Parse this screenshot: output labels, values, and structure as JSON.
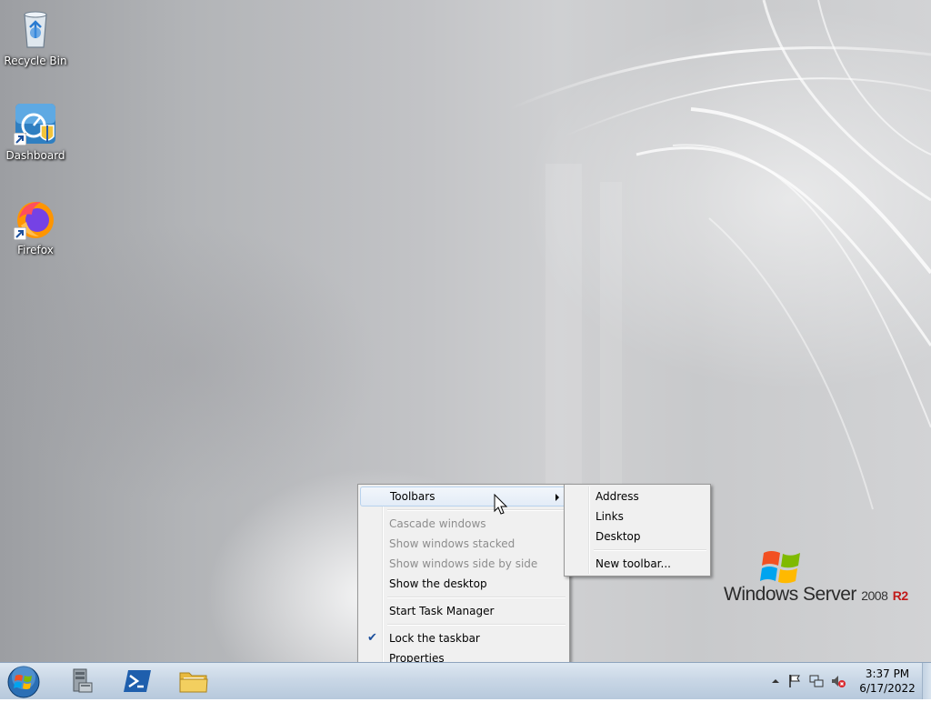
{
  "desktop": {
    "icons": [
      {
        "label": "Recycle Bin",
        "icon": "recycle-bin-icon"
      },
      {
        "label": "Dashboard",
        "icon": "dashboard-icon"
      },
      {
        "label": "Firefox",
        "icon": "firefox-icon"
      }
    ],
    "brand": {
      "name": "Windows Server",
      "version": "2008",
      "edition": "R2"
    }
  },
  "context_menu": {
    "items": [
      {
        "label": "Toolbars",
        "state": "highlighted",
        "has_submenu": true
      },
      {
        "label": "Cascade windows",
        "state": "disabled"
      },
      {
        "label": "Show windows stacked",
        "state": "disabled"
      },
      {
        "label": "Show windows side by side",
        "state": "disabled"
      },
      {
        "label": "Show the desktop",
        "state": "enabled"
      },
      {
        "label": "Start Task Manager",
        "state": "enabled"
      },
      {
        "label": "Lock the taskbar",
        "state": "checked"
      },
      {
        "label": "Properties",
        "state": "enabled"
      }
    ]
  },
  "toolbars_submenu": {
    "items": [
      {
        "label": "Address"
      },
      {
        "label": "Links"
      },
      {
        "label": "Desktop"
      },
      {
        "label": "New toolbar..."
      }
    ]
  },
  "taskbar": {
    "pinned": [
      {
        "name": "Server Manager",
        "icon": "server-manager-icon"
      },
      {
        "name": "Windows PowerShell",
        "icon": "powershell-icon"
      },
      {
        "name": "Windows Explorer",
        "icon": "folder-icon"
      }
    ],
    "tray": {
      "icons": [
        "show-hidden-icons-arrow",
        "action-center-flag-icon",
        "network-icon",
        "volume-muted-icon"
      ],
      "time": "3:37 PM",
      "date": "6/17/2022"
    }
  },
  "colors": {
    "accent": "#1c4f9c",
    "menu_bg": "#f0f0f0",
    "highlight_border": "#b8d2ed",
    "taskbar": "#c9d7e6"
  }
}
